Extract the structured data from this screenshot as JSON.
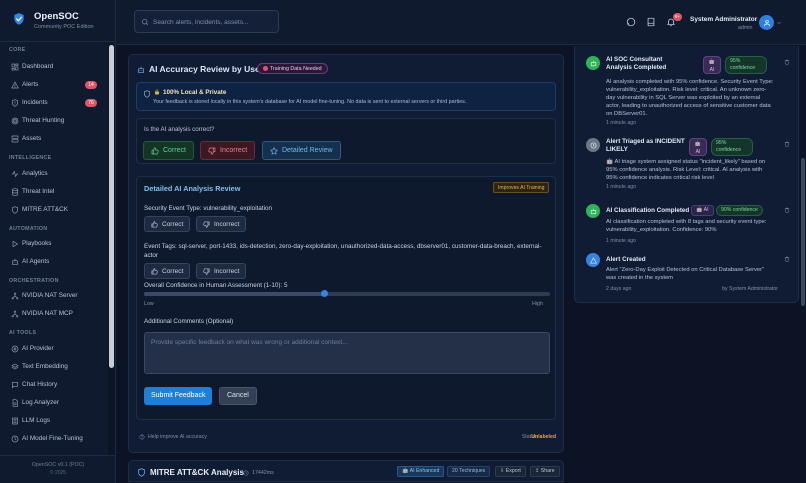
{
  "brand": {
    "name": "OpenSOC",
    "edition": "Community POC Edition"
  },
  "sidebar": {
    "sections": [
      {
        "label": "CORE",
        "items": [
          {
            "label": "Dashboard",
            "icon": "dashboard-icon"
          },
          {
            "label": "Alerts",
            "icon": "alert-triangle-icon",
            "count": "14"
          },
          {
            "label": "Incidents",
            "icon": "shield-alert-icon",
            "count": "76"
          },
          {
            "label": "Threat Hunting",
            "icon": "target-icon"
          },
          {
            "label": "Assets",
            "icon": "server-icon"
          }
        ]
      },
      {
        "label": "INTELLIGENCE",
        "items": [
          {
            "label": "Analytics",
            "icon": "activity-icon"
          },
          {
            "label": "Threat Intel",
            "icon": "database-icon"
          },
          {
            "label": "MITRE ATT&CK",
            "icon": "shield-icon"
          }
        ]
      },
      {
        "label": "AUTOMATION",
        "items": [
          {
            "label": "Playbooks",
            "icon": "play-icon"
          },
          {
            "label": "AI Agents",
            "icon": "bot-icon"
          }
        ]
      },
      {
        "label": "ORCHESTRATION",
        "items": [
          {
            "label": "NVIDIA NAT Server",
            "icon": "network-icon"
          },
          {
            "label": "NVIDIA NAT MCP",
            "icon": "network-icon"
          }
        ]
      },
      {
        "label": "AI TOOLS",
        "items": [
          {
            "label": "AI Provider",
            "icon": "cpu-icon"
          },
          {
            "label": "Text Embedding",
            "icon": "layers-icon"
          },
          {
            "label": "Chat History",
            "icon": "chat-icon"
          },
          {
            "label": "Log Analyzer",
            "icon": "file-text-icon"
          },
          {
            "label": "LLM Logs",
            "icon": "list-icon"
          },
          {
            "label": "AI Model Fine-Tuning",
            "icon": "sliders-icon"
          }
        ]
      }
    ],
    "footer_version": "OpenSOC v0.1 (POC)",
    "footer_copyright": "© 2025"
  },
  "header": {
    "search_placeholder": "Search alerts, incidents, assets...",
    "notification_count": "9+",
    "user_name": "System Administrator",
    "user_role": "admin"
  },
  "review": {
    "title": "AI Accuracy Review by User",
    "badge": "Training Data Needed",
    "privacy_title": "100% Local & Private",
    "privacy_desc": "Your feedback is stored locally in this system's database for AI model fine-tuning. No data is sent to external servers or third parties.",
    "question": "Is the AI analysis correct?",
    "btn_correct": "Correct",
    "btn_incorrect": "Incorrect",
    "btn_detailed": "Detailed Review",
    "detail_title": "Detailed AI Analysis Review",
    "improves_badge": "Improves AI Training",
    "event_type_label": "Security Event Type: vulnerability_exploitation",
    "event_tags_label": "Event Tags: sql-server, port-1433, ids-detection, zero-day-exploitation, unauthorized-data-access, dbserver01, customer-data-breach, external-actor",
    "small_correct": "Correct",
    "small_incorrect": "Incorrect",
    "confidence_label": "Overall Confidence in Human Assessment (1-10): 5",
    "confidence_value": 5,
    "confidence_max": 10,
    "low": "Low",
    "high": "High",
    "comments_label": "Additional Comments (Optional)",
    "comments_placeholder": "Provide specific feedback on what was wrong or additional context...",
    "submit": "Submit Feedback",
    "cancel": "Cancel",
    "help": "Help improve AI accuracy",
    "status_label": "Status:",
    "status_value": "Unlabeled"
  },
  "mitre": {
    "title": "MITRE ATT&CK Analysis",
    "time": "17442ms",
    "chip_ai": "AI Enhanced",
    "chip_techniques": "20 Techniques",
    "chip_export": "Export",
    "chip_share": "Share"
  },
  "timeline": [
    {
      "title": "AI SOC Consultant Analysis Completed",
      "ai": "AI",
      "confidence": "95% confidence",
      "desc": "AI analysis completed with 95% confidence. Security Event Type: vulnerability_exploitation. Risk level: critical. An unknown zero-day vulnerability in SQL Server was exploited by an external actor, leading to unauthorized access of sensitive customer data on DBServer01.",
      "time": "1 minute ago",
      "color": "#2fb35a"
    },
    {
      "title": "Alert Triaged as INCIDENT LIKELY",
      "ai": "AI",
      "confidence": "95% confidence",
      "desc": "🤖 AI triage system assigned status \"incident_likely\" based on 95% confidence analysis. Risk Level: critical. AI analysis with 95% confidence indicates critical risk level",
      "time": "1 minute ago",
      "color": "#6b7686"
    },
    {
      "title": "AI Classification Completed",
      "ai": "AI",
      "confidence": "90% confidence",
      "desc": "AI classification completed with 8 tags and security event type: vulnerability_exploitation. Confidence: 90%",
      "time": "1 minute ago",
      "color": "#2fb35a"
    },
    {
      "title": "Alert Created",
      "desc": "Alert \"Zero-Day Exploit Detected on Critical Database Server\" was created in the system",
      "time": "2 days ago",
      "by": "by System Administrator",
      "color": "#3a82e0"
    }
  ]
}
